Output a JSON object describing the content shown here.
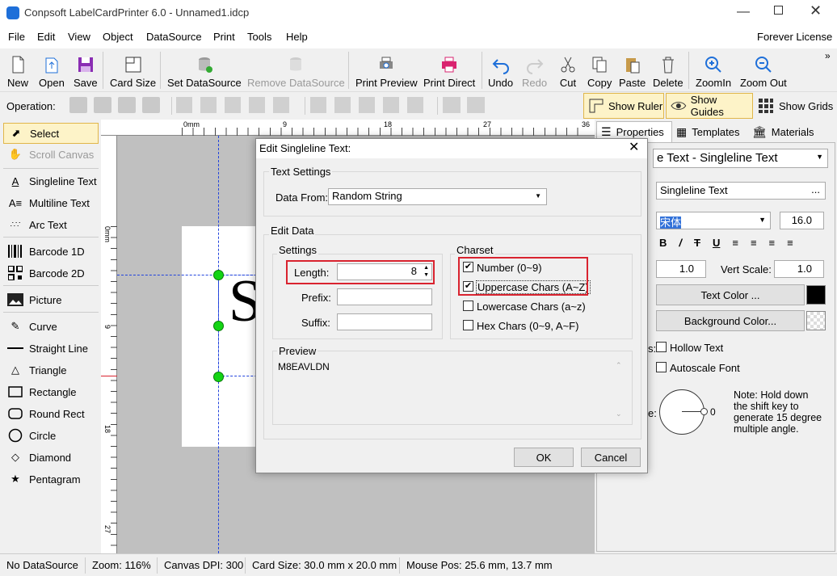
{
  "window": {
    "title": "Conpsoft LabelCardPrinter 6.0 - Unnamed1.idcp",
    "license": "Forever License"
  },
  "menu": [
    "File",
    "Edit",
    "View",
    "Object",
    "DataSource",
    "Print",
    "Tools",
    "Help"
  ],
  "toolbar": {
    "new": "New",
    "open": "Open",
    "save": "Save",
    "card_size": "Card Size",
    "set_ds": "Set DataSource",
    "remove_ds": "Remove DataSource",
    "print_preview": "Print Preview",
    "print_direct": "Print Direct",
    "undo": "Undo",
    "redo": "Redo",
    "cut": "Cut",
    "copy": "Copy",
    "paste": "Paste",
    "delete": "Delete",
    "zoom_in": "ZoomIn",
    "zoom_out": "Zoom Out"
  },
  "opbar": {
    "label": "Operation:",
    "show_ruler": "Show Ruler",
    "show_guides": "Show Guides",
    "show_grids": "Show Grids"
  },
  "tools": [
    "Select",
    "Scroll Canvas",
    "Singleline Text",
    "Multiline Text",
    "Arc Text",
    "Barcode 1D",
    "Barcode 2D",
    "Picture",
    "Curve",
    "Straight Line",
    "Triangle",
    "Rectangle",
    "Round Rect",
    "Circle",
    "Diamond",
    "Pentagram"
  ],
  "ruler": {
    "h": [
      "0mm",
      "9",
      "18",
      "27",
      "36"
    ],
    "v": [
      "0mm",
      "9",
      "18",
      "27"
    ]
  },
  "canvas": {
    "text": "S"
  },
  "right": {
    "tabs": [
      "Properties",
      "Templates",
      "Materials"
    ],
    "object": "e Text - Singleline Text",
    "name_label": "a:",
    "name_value": "Singleline Text",
    "font_label": "t:",
    "font_value": "宋体",
    "font_size": "16.0",
    "scale_label": "e:",
    "scale_value": "1.0",
    "vert_scale_label": "Vert Scale:",
    "vert_scale_value": "1.0",
    "text_color_label": "r:",
    "text_color": "Text Color ...",
    "bg_color_label": "r:",
    "bg_color": "Background Color...",
    "effects_label": "s:",
    "hollow": "Hollow Text",
    "autoscale": "Autoscale Font",
    "angle_label": "e:",
    "angle_value": "0",
    "note": "Note: Hold down the shift key to generate 15 degree multiple angle.",
    "more": "..."
  },
  "dialog": {
    "title": "Edit Singleline Text:",
    "text_settings": "Text Settings",
    "data_from_label": "Data From:",
    "data_from_value": "Random String",
    "edit_data": "Edit Data",
    "settings": "Settings",
    "length_label": "Length:",
    "length_value": "8",
    "prefix_label": "Prefix:",
    "suffix_label": "Suffix:",
    "charset": "Charset",
    "number": "Number (0~9)",
    "uppercase": "Uppercase Chars (A~Z)",
    "lowercase": "Lowercase Chars (a~z)",
    "hex": "Hex Chars (0~9, A~F)",
    "preview": "Preview",
    "preview_value": "M8EAVLDN",
    "ok": "OK",
    "cancel": "Cancel"
  },
  "status": {
    "ds": "No DataSource",
    "zoom": "Zoom: 116%",
    "dpi": "Canvas DPI: 300",
    "card": "Card Size: 30.0 mm x 20.0 mm",
    "mouse": "Mouse Pos: 25.6 mm, 13.7 mm"
  }
}
